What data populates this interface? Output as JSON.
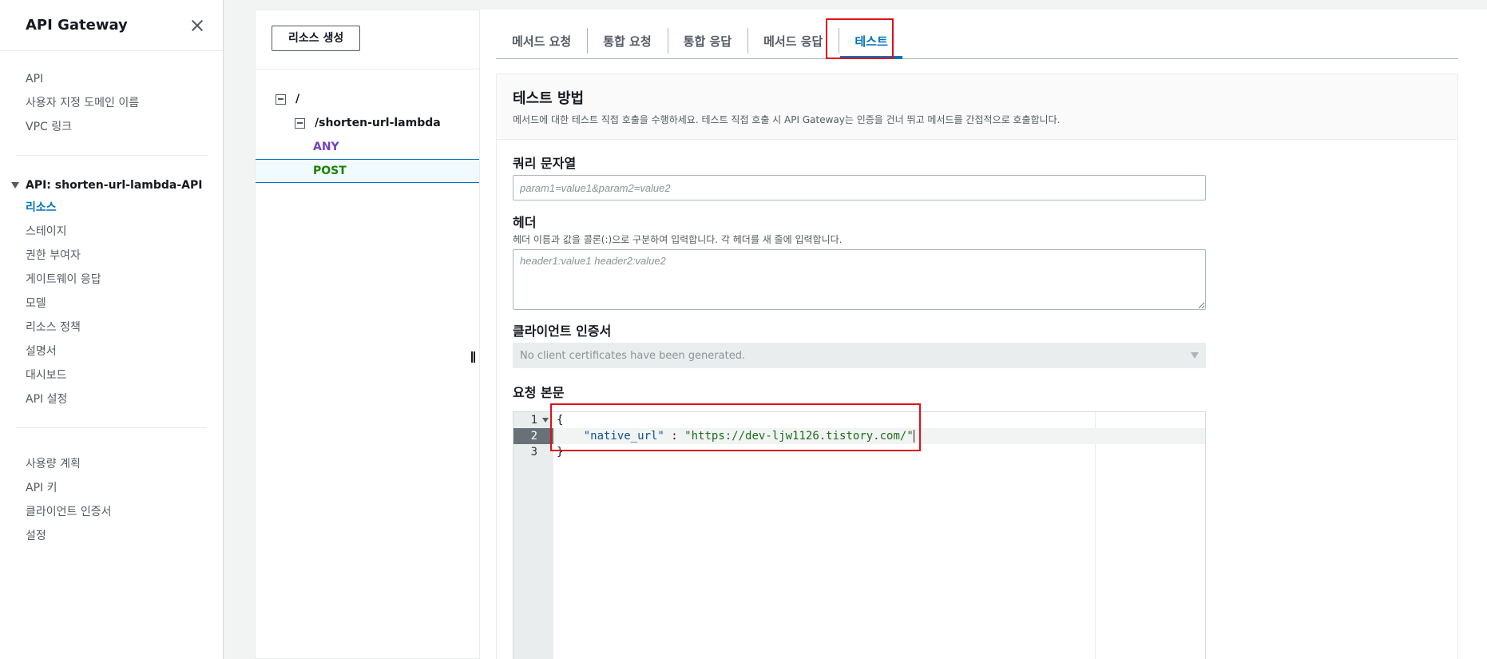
{
  "sidebar": {
    "title": "API Gateway",
    "top_links": [
      "API",
      "사용자 지정 도메인 이름",
      "VPC 링크"
    ],
    "api_group_label": "API: shorten-url-lambda-API",
    "api_links": [
      "리소스",
      "스테이지",
      "권한 부여자",
      "게이트웨이 응답",
      "모델",
      "리소스 정책",
      "설명서",
      "대시보드",
      "API 설정"
    ],
    "active_link": "리소스",
    "bottom_links": [
      "사용량 계획",
      "API 키",
      "클라이언트 인증서",
      "설정"
    ]
  },
  "resources": {
    "create_button": "리소스 생성",
    "tree": [
      {
        "label": "/",
        "type": "path"
      },
      {
        "label": "/shorten-url-lambda",
        "type": "path"
      },
      {
        "label": "ANY",
        "type": "method"
      },
      {
        "label": "POST",
        "type": "method",
        "selected": true
      }
    ]
  },
  "tabs": {
    "items": [
      "메서드 요청",
      "통합 요청",
      "통합 응답",
      "메서드 응답",
      "테스트"
    ],
    "active": "테스트"
  },
  "test": {
    "title": "테스트 방법",
    "description": "메서드에 대한 테스트 직접 호출을 수행하세요. 테스트 직접 호출 시 API Gateway는 인증을 건너 뛰고 메서드를 간접적으로 호출합니다.",
    "query_label": "쿼리 문자열",
    "query_placeholder": "param1=value1&param2=value2",
    "header_label": "헤더",
    "header_desc": "헤더 이름과 값을 콜론(:)으로 구분하여 입력합니다. 각 헤더를 새 줄에 입력합니다.",
    "header_placeholder": "header1:value1 header2:value2",
    "cert_label": "클라이언트 인증서",
    "cert_value": "No client certificates have been generated.",
    "body_label": "요청 본문",
    "body": {
      "line_numbers": [
        "1",
        "2",
        "3"
      ],
      "lines": [
        "{",
        "    \"native_url\" : \"https://dev-ljw1126.tistory.com/\"",
        "}"
      ],
      "key": "\"native_url\"",
      "separator": " : ",
      "value": "\"https://dev-ljw1126.tistory.com/\""
    }
  },
  "colors": {
    "accent": "#0073bb",
    "any_method": "#6f42c1",
    "post_method": "#1d8102",
    "highlight_box": "#e0101a"
  }
}
